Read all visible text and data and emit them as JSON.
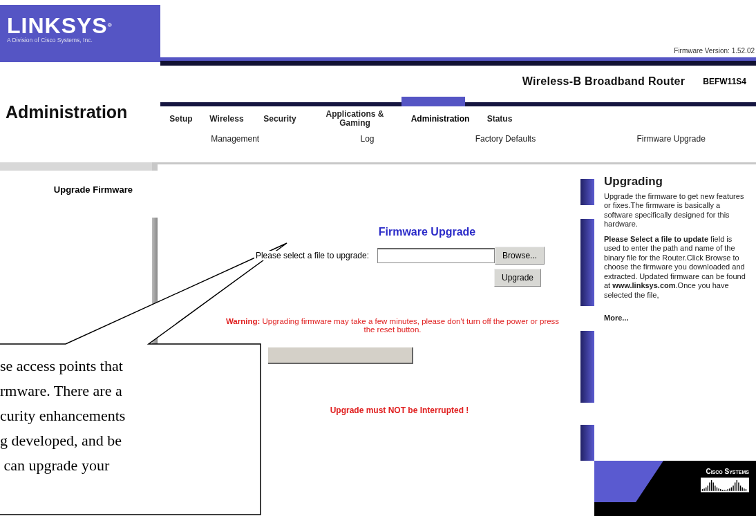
{
  "logo": {
    "name": "LINKSYS",
    "mark": "®",
    "tagline": "A Division of Cisco Systems, Inc."
  },
  "firmware_version": "Firmware Version: 1.52.02",
  "product": {
    "name": "Wireless-B Broadband Router",
    "model": "BEFW11S4"
  },
  "page_title": "Administration",
  "tabs": [
    {
      "label": "Setup",
      "selected": false
    },
    {
      "label": "Wireless",
      "selected": false
    },
    {
      "label": "Security",
      "selected": false
    },
    {
      "label": "Applications & Gaming",
      "selected": false
    },
    {
      "label": "Administration",
      "selected": true
    },
    {
      "label": "Status",
      "selected": false
    }
  ],
  "subtabs": [
    "Management",
    "Log",
    "Factory Defaults",
    "Firmware Upgrade"
  ],
  "section_label": "Upgrade Firmware",
  "form": {
    "heading": "Firmware Upgrade",
    "file_label": "Please select a file to upgrade:",
    "browse_button": "Browse...",
    "upgrade_button": "Upgrade",
    "warning_prefix": "Warning:",
    "warning": "Upgrading firmware may take a few minutes, please don't turn off the power or press the reset button.",
    "notice": "Upgrade must NOT be Interrupted !"
  },
  "help": {
    "title": "Upgrading",
    "paragraph_1": "Upgrade the firmware to get new features or fixes.The firmware is basically a software specifically designed for this hardware.",
    "paragraph_2": "**Please Select a file to update** field is used to enter the path and name of the binary file for the Router.Click Browse to choose the firmware you downloaded and extracted. Updated firmware can be found at **www.linksys.com**.Once you have selected the file,",
    "more": "More..."
  },
  "brand": "Cisco Systems",
  "callout": {
    "lines": [
      "se access points that",
      "rmware. There are a",
      "curity enhancements",
      "g developed, and be",
      " can upgrade your"
    ]
  }
}
